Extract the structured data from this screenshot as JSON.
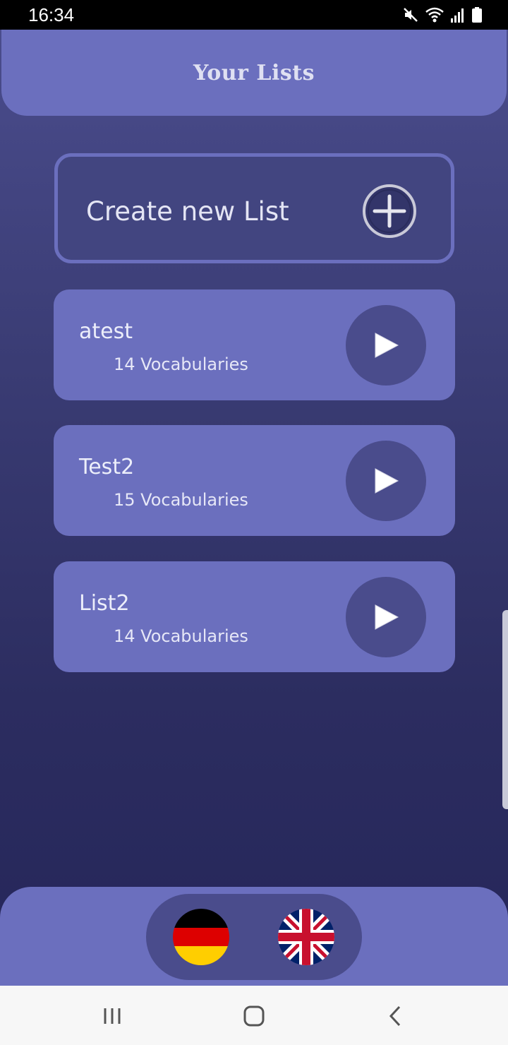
{
  "status_bar": {
    "time": "16:34",
    "icons": [
      "mute-icon",
      "wifi-icon",
      "signal-icon",
      "battery-icon"
    ]
  },
  "header": {
    "title": "Your Lists"
  },
  "create_list": {
    "label": "Create new List",
    "icon": "plus-circle-icon"
  },
  "lists": [
    {
      "name": "atest",
      "count": "14 Vocabularies"
    },
    {
      "name": "Test2",
      "count": "15 Vocabularies"
    },
    {
      "name": "List2",
      "count": "14 Vocabularies"
    }
  ],
  "languages": [
    {
      "name": "german-flag-icon"
    },
    {
      "name": "uk-flag-icon"
    }
  ],
  "nav_bar": {
    "buttons": [
      "recent-apps-icon",
      "home-icon",
      "back-icon"
    ]
  },
  "colors": {
    "card": "#6b6fbe",
    "card_dark": "#4a4c8c",
    "background_top": "#4a4c8c",
    "background_bottom": "#25265a"
  }
}
